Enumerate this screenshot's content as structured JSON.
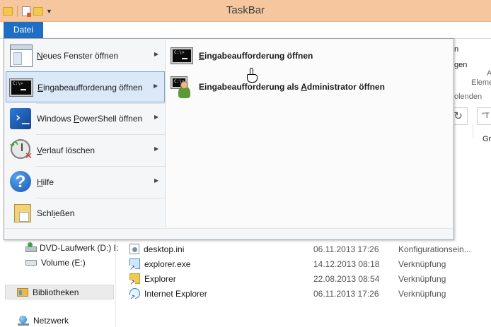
{
  "window": {
    "title": "TaskBar"
  },
  "ribbon": {
    "file_tab": "Datei",
    "partial_labels": {
      "n": "n",
      "gen": "gen",
      "a": "A",
      "eleme": "Eleme",
      "olenden": "olenden",
      "gr": "Gr"
    }
  },
  "address": {
    "search_text": "\"T"
  },
  "file_menu": {
    "items": [
      {
        "label_pre": "",
        "label_u": "N",
        "label_post": "eues Fenster öffnen",
        "icon": "new-window-icon",
        "has_submenu": true
      },
      {
        "label_pre": "",
        "label_u": "E",
        "label_post": "ingabeaufforderung öffnen",
        "icon": "command-prompt-icon",
        "has_submenu": true,
        "hovered": true
      },
      {
        "label_pre": "Windows ",
        "label_u": "P",
        "label_post": "owerShell öffnen",
        "icon": "powershell-icon",
        "has_submenu": true
      },
      {
        "label_pre": "",
        "label_u": "V",
        "label_post": "erlauf löschen",
        "icon": "clear-history-icon",
        "has_submenu": true
      },
      {
        "label_pre": "",
        "label_u": "H",
        "label_post": "ilfe",
        "icon": "help-icon",
        "has_submenu": true
      },
      {
        "label_pre": "Schl",
        "label_u": "i",
        "label_post": "eßen",
        "icon": "close-folder-icon",
        "has_submenu": false
      }
    ],
    "submenu": [
      {
        "label_pre": "",
        "label_u": "E",
        "label_post": "ingabeaufforderung öffnen",
        "icon": "command-prompt-icon"
      },
      {
        "label_pre": "Eingabeaufforderung als ",
        "label_u": "A",
        "label_post": "dministrator öffnen",
        "icon": "admin-command-prompt-icon"
      }
    ]
  },
  "nav_pane": {
    "items": [
      {
        "label": "DVD-Laufwerk (D:) I:",
        "icon": "dvd-drive-icon"
      },
      {
        "label": "Volume (E:)",
        "icon": "drive-icon"
      },
      {
        "label": "Bibliotheken",
        "icon": "libraries-icon",
        "selected": true
      },
      {
        "label": "Netzwerk",
        "icon": "network-icon"
      }
    ]
  },
  "file_list": {
    "rows": [
      {
        "name": "desktop.ini",
        "date": "06.11.2013 17:26",
        "type": "Konfigurationsein...",
        "icon": "ini-file-icon"
      },
      {
        "name": "explorer.exe",
        "date": "14.12.2013 08:18",
        "type": "Verknüpfung",
        "icon": "shortcut-icon"
      },
      {
        "name": "Explorer",
        "date": "22.08.2013 08:54",
        "type": "Verknüpfung",
        "icon": "folder-shortcut-icon"
      },
      {
        "name": "Internet Explorer",
        "date": "06.11.2013 17:26",
        "type": "Verknüpfung",
        "icon": "ie-shortcut-icon"
      }
    ]
  }
}
